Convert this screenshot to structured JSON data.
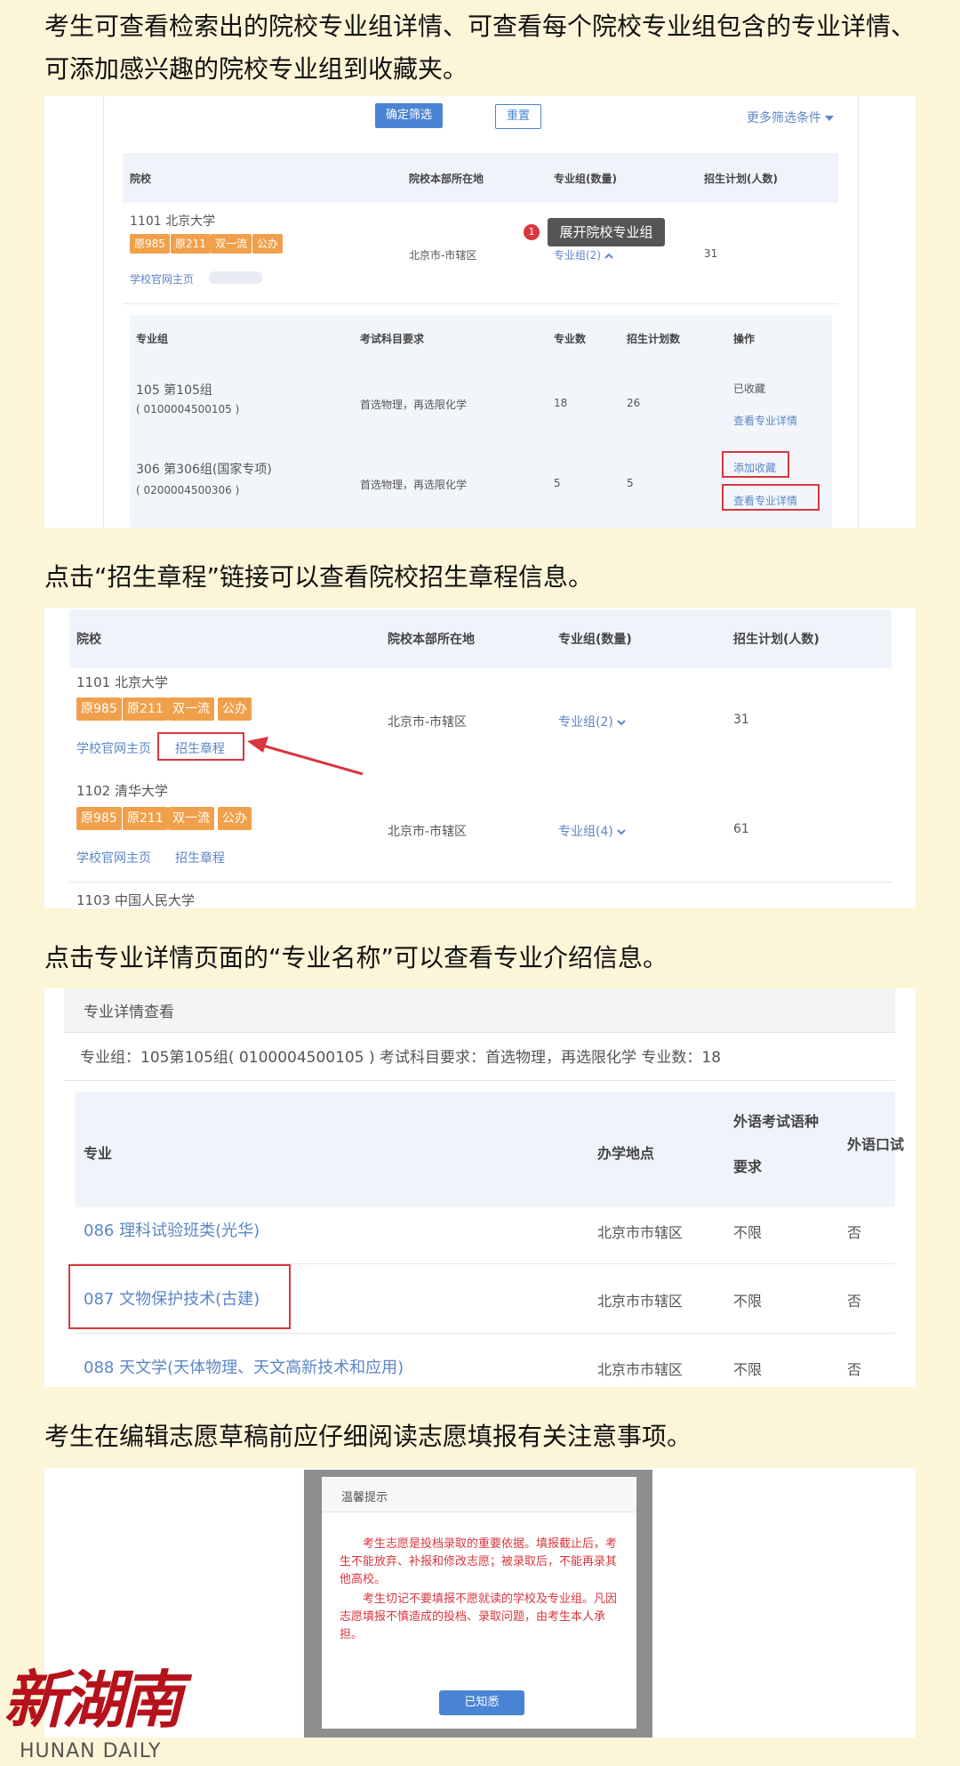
{
  "captions": {
    "c1": "考生可查看检索出的院校专业组详情、可查看每个院校专业组包含的专业详情、可添加感兴趣的院校专业组到收藏夹。",
    "c2": "点击“招生章程”链接可以查看院校招生章程信息。",
    "c3": "点击专业详情页面的“专业名称”可以查看专业介绍信息。",
    "c4": "考生在编辑志愿草稿前应仔细阅读志愿填报有关注意事项。"
  },
  "shot1": {
    "confirm_btn": "确定筛选",
    "reset_btn": "重置",
    "more_filters": "更多筛选条件",
    "headers": [
      "院校",
      "院校本部所在地",
      "专业组(数量)",
      "招生计划(人数)"
    ],
    "school": {
      "name": "1101 北京大学",
      "tags": [
        "原985",
        "原211",
        "双一流",
        "公办"
      ],
      "homepage": "学校官网主页",
      "location": "北京市-市辖区",
      "groups": "专业组(2)",
      "plan": "31"
    },
    "tooltip_badge": "1",
    "tooltip": "展开院校专业组",
    "sub_headers": [
      "专业组",
      "考试科目要求",
      "专业数",
      "招生计划数",
      "操作"
    ],
    "rows": [
      {
        "name": "105 第105组",
        "code": "( 0100004500105 )",
        "subject": "首选物理，再选限化学",
        "count": "18",
        "plan": "26",
        "action1": "已收藏",
        "action2": "查看专业详情"
      },
      {
        "name": "306 第306组(国家专项)",
        "code": "( 0200004500306 )",
        "subject": "首选物理，再选限化学",
        "count": "5",
        "plan": "5",
        "action1": "添加收藏",
        "action2": "查看专业详情"
      }
    ]
  },
  "shot2": {
    "headers": [
      "院校",
      "院校本部所在地",
      "专业组(数量)",
      "招生计划(人数)"
    ],
    "schools": [
      {
        "name": "1101 北京大学",
        "tags": [
          "原985",
          "原211",
          "双一流",
          "公办"
        ],
        "homepage": "学校官网主页",
        "charter": "招生章程",
        "location": "北京市-市辖区",
        "groups": "专业组(2)",
        "plan": "31"
      },
      {
        "name": "1102 清华大学",
        "tags": [
          "原985",
          "原211",
          "双一流",
          "公办"
        ],
        "homepage": "学校官网主页",
        "charter": "招生章程",
        "location": "北京市-市辖区",
        "groups": "专业组(4)",
        "plan": "61"
      }
    ],
    "next_school": "1103 中国人民大学"
  },
  "shot3": {
    "title": "专业详情查看",
    "info": "专业组：105第105组( 0100004500105 )  考试科目要求：首选物理，再选限化学  专业数：18",
    "headers": {
      "major": "专业",
      "place": "办学地点",
      "lang1": "外语考试语种",
      "lang2": "要求",
      "oral": "外语口试"
    },
    "rows": [
      {
        "major": "086 理科试验班类(光华)",
        "place": "北京市市辖区",
        "lang": "不限",
        "oral": "否"
      },
      {
        "major": "087 文物保护技术(古建)",
        "place": "北京市市辖区",
        "lang": "不限",
        "oral": "否"
      },
      {
        "major": "088 天文学(天体物理、天文高新技术和应用)",
        "place": "北京市市辖区",
        "lang": "不限",
        "oral": "否"
      }
    ]
  },
  "shot4": {
    "dialog_title": "温馨提示",
    "para1": "考生志愿是投档录取的重要依据。填报截止后，考生不能放弃、补报和修改志愿；被录取后，不能再录其他高校。",
    "para2": "考生切记不要填报不愿就读的学校及专业组。凡因志愿填报不慎造成的投档、录取问题，由考生本人承担。",
    "ok_btn": "已知悉"
  },
  "watermark": {
    "logo": "新湖南",
    "sub": "HUNAN DAILY"
  },
  "colors": {
    "tag": "#f0a04b",
    "link": "#5b86c7",
    "highlight": "#d9363e",
    "primary_btn": "#4a84d4"
  }
}
